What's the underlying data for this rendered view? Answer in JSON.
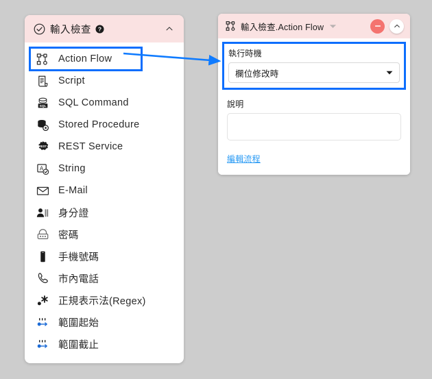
{
  "theme": {
    "page_background": "#cdcdcd",
    "header_pink": "#fae2e2",
    "highlight_blue": "#0d6efd",
    "link_blue": "#2b9bf4",
    "delete_red": "#f4736f"
  },
  "validation_panel": {
    "icon": "check-circle-icon",
    "title": "輸入檢查",
    "help_icon": "help-icon",
    "collapse_icon": "chevron-up-icon",
    "items": [
      {
        "icon": "action-flow-icon",
        "label": "Action Flow",
        "selected": true
      },
      {
        "icon": "script-icon",
        "label": "Script",
        "selected": false
      },
      {
        "icon": "sql-command-icon",
        "label": "SQL Command",
        "selected": false
      },
      {
        "icon": "stored-procedure-icon",
        "label": "Stored Procedure",
        "selected": false
      },
      {
        "icon": "rest-service-icon",
        "label": "REST Service",
        "selected": false
      },
      {
        "icon": "string-icon",
        "label": "String",
        "selected": false
      },
      {
        "icon": "email-icon",
        "label": "E-Mail",
        "selected": false
      },
      {
        "icon": "id-card-icon",
        "label": "身分證",
        "selected": false
      },
      {
        "icon": "password-icon",
        "label": "密碼",
        "selected": false
      },
      {
        "icon": "mobile-phone-icon",
        "label": "手機號碼",
        "selected": false
      },
      {
        "icon": "telephone-icon",
        "label": "市內電話",
        "selected": false
      },
      {
        "icon": "regex-icon",
        "label": "正規表示法(Regex)",
        "selected": false
      },
      {
        "icon": "range-start-icon",
        "label": "範圍起始",
        "selected": false
      },
      {
        "icon": "range-end-icon",
        "label": "範圍截止",
        "selected": false
      }
    ]
  },
  "properties_panel": {
    "icon": "action-flow-icon",
    "title": "輸入檢查.Action Flow",
    "title_caret_icon": "caret-down-icon",
    "delete_icon": "minus-icon",
    "collapse_icon": "chevron-up-icon",
    "timing": {
      "label": "執行時機",
      "value": "欄位修改時",
      "caret_icon": "caret-down-icon"
    },
    "description": {
      "label": "說明",
      "value": "",
      "placeholder": ""
    },
    "edit_flow_link": "編輯流程"
  },
  "annotation": {
    "arrow": "blue-arrow-connector"
  }
}
